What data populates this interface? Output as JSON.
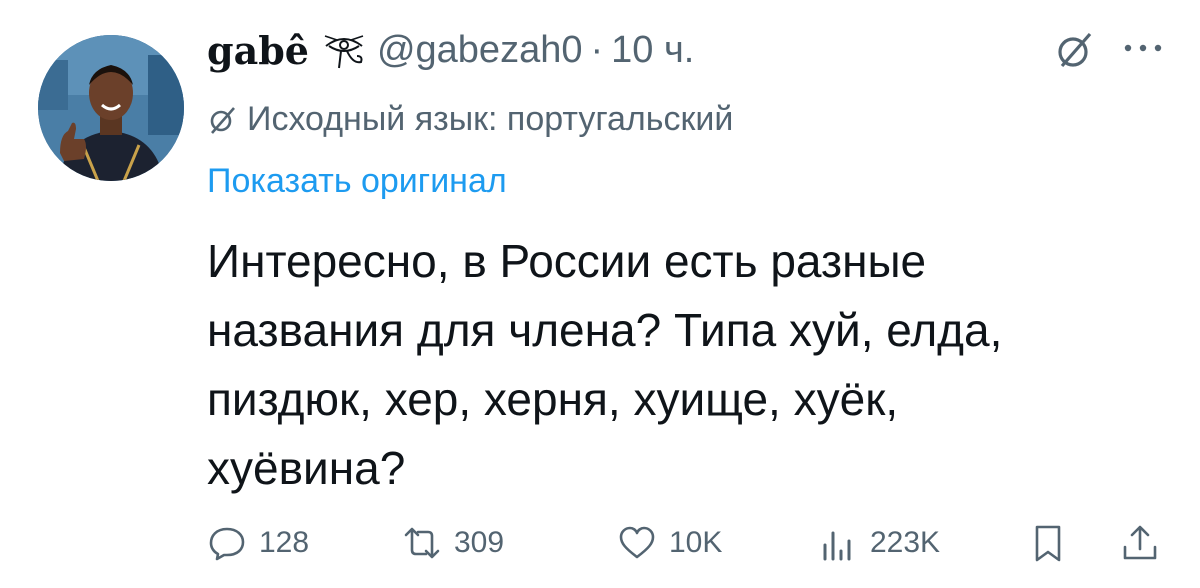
{
  "author": {
    "display_name": "gabê",
    "emoji_icon": "eye-of-horus-icon",
    "handle": "@gabezah0",
    "separator": "·",
    "time": "10 ч."
  },
  "translation": {
    "note": "Исходный язык: португальский",
    "show_original": "Показать оригинал"
  },
  "tweet": {
    "lines": [
      "Интересно, в России есть разные",
      "названия для члена? Типа хуй, елда,",
      "пиздюк, хер, херня, хуище, хуёк,",
      "хуёвина?"
    ]
  },
  "actions": {
    "replies": "128",
    "reposts": "309",
    "likes": "10K",
    "views": "223K"
  },
  "colors": {
    "text": "#0f1419",
    "secondary": "#536471",
    "link": "#1d9bf0"
  }
}
